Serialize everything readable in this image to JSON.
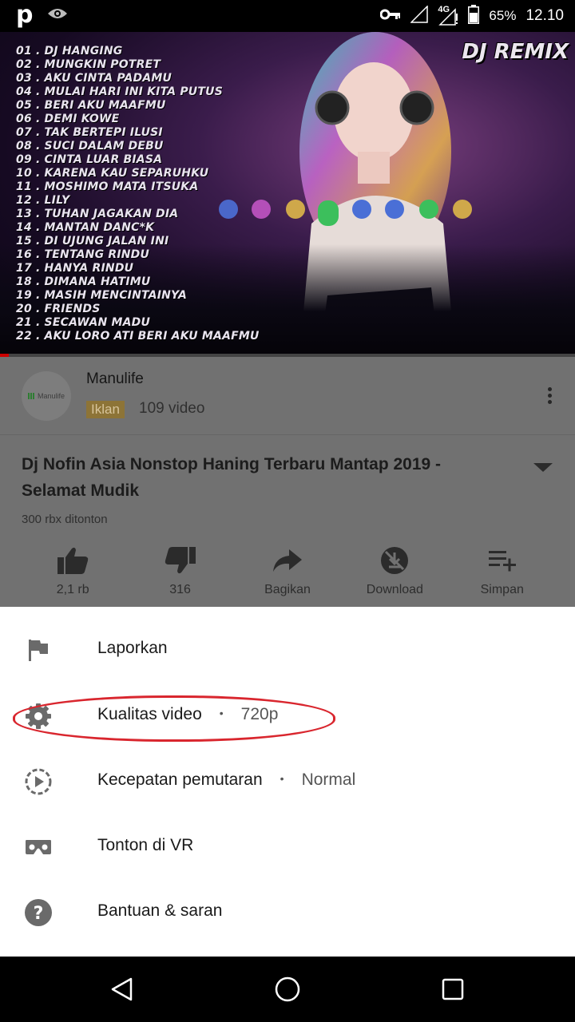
{
  "status_bar": {
    "app_letter": "p",
    "network": "4G",
    "battery": "65%",
    "time": "12.10"
  },
  "video": {
    "tracklist": [
      "01 . DJ HANGING",
      "02 . MUNGKIN POTRET",
      "03 . AKU CINTA PADAMU",
      "04 . MULAI HARI INI KITA PUTUS",
      "05 . BERI AKU MAAFMU",
      "06 . DEMI KOWE",
      "07 . TAK BERTEPI ILUSI",
      "08 . SUCI DALAM DEBU",
      "09 . CINTA LUAR BIASA",
      "10 . KARENA KAU SEPARUHKU",
      "11 . MOSHIMO MATA ITSUKA",
      "12 . LILY",
      "13 . TUHAN JAGAKAN DIA",
      "14 . MANTAN DANC*K",
      "15 . DI UJUNG JALAN INI",
      "16 . TENTANG RINDU",
      "17 . HANYA RINDU",
      "18 . DIMANA HATIMU",
      "19 . MASIH MENCINTAINYA",
      "20 . FRIENDS",
      "21 . SECAWAN MADU",
      "22 . AKU LORO ATI BERI AKU MAAFMU"
    ],
    "overlay_title": "DJ REMIX",
    "progress_fraction": 0.015,
    "accent_color": "#cc0000"
  },
  "ad": {
    "channel_name": "Manulife",
    "avatar_text": "Manulife",
    "badge": "Iklan",
    "video_count": "109 video",
    "badge_color": "#8d7437"
  },
  "details": {
    "title": "Dj Nofin Asia Nonstop Haning Terbaru Mantap 2019 - Selamat Mudik",
    "views": "300 rbx ditonton"
  },
  "actions": [
    {
      "label": "2,1 rb",
      "icon": "thumb-up-icon"
    },
    {
      "label": "316",
      "icon": "thumb-down-icon"
    },
    {
      "label": "Bagikan",
      "icon": "share-icon"
    },
    {
      "label": "Download",
      "icon": "download-off-icon"
    },
    {
      "label": "Simpan",
      "icon": "playlist-add-icon"
    }
  ],
  "menu": [
    {
      "label": "Laporkan",
      "icon": "flag-icon"
    },
    {
      "label": "Kualitas video",
      "value": "720p",
      "icon": "gear-icon",
      "highlighted": true
    },
    {
      "label": "Kecepatan pemutaran",
      "value": "Normal",
      "icon": "playback-speed-icon"
    },
    {
      "label": "Tonton di VR",
      "icon": "vr-headset-icon"
    },
    {
      "label": "Bantuan & saran",
      "icon": "help-icon"
    }
  ],
  "menu_separator": "•",
  "highlight_color": "#d9262e"
}
